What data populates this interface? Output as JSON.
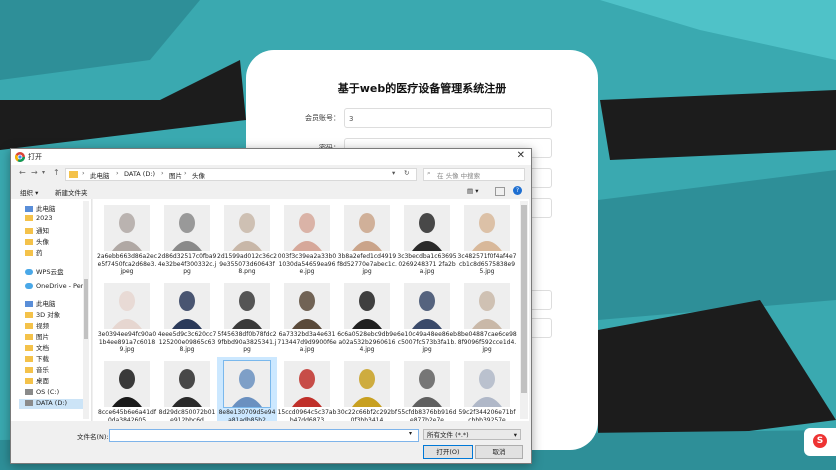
{
  "background": {
    "teal": "#3aa9b0",
    "dark": "#1c1c1c"
  },
  "form": {
    "title": "基于web的医疗设备管理系统注册",
    "rows": [
      {
        "label": "会员账号：",
        "value": "3"
      },
      {
        "label": "密码：",
        "value": ""
      }
    ]
  },
  "dialog": {
    "title": "打开",
    "close": "✕",
    "breadcrumbs": [
      "此电脑",
      "DATA (D:)",
      "图片",
      "头像"
    ],
    "search_placeholder": "在 头像 中搜索",
    "toolbar": {
      "organize": "组织 ▾",
      "new_folder": "新建文件夹"
    },
    "sidebar": [
      {
        "label": "此电脑",
        "icon": "pc"
      },
      {
        "label": "2023",
        "icon": "folder"
      },
      {
        "label": "通知",
        "icon": "folder"
      },
      {
        "label": "头像",
        "icon": "folder"
      },
      {
        "label": "药",
        "icon": "folder"
      },
      {
        "label": "WPS云盘",
        "icon": "cloud"
      },
      {
        "label": "OneDrive - Pers",
        "icon": "cloud"
      },
      {
        "label": "此电脑",
        "icon": "pc"
      },
      {
        "label": "3D 对象",
        "icon": "folder"
      },
      {
        "label": "视频",
        "icon": "folder"
      },
      {
        "label": "图片",
        "icon": "folder"
      },
      {
        "label": "文档",
        "icon": "folder"
      },
      {
        "label": "下载",
        "icon": "folder"
      },
      {
        "label": "音乐",
        "icon": "folder"
      },
      {
        "label": "桌面",
        "icon": "folder"
      },
      {
        "label": "OS (C:)",
        "icon": "drive"
      },
      {
        "label": "DATA (D:)",
        "icon": "drive"
      }
    ],
    "files": [
      {
        "name": "2a6ebb663d86a2ece5f7450fca2d68e3.jpeg",
        "color": "#b0a8a4"
      },
      {
        "name": "2d86d32517c0fba94e32be4f300332c.jpg",
        "color": "#8a8a8a"
      },
      {
        "name": "2d1599ad012c36c29e355073d60643f8.png",
        "color": "#c8b7a8"
      },
      {
        "name": "003f3c39ea2a33b01030da54659ea96e.jpg",
        "color": "#d6a89a"
      },
      {
        "name": "3b8a2efed1cd4919f8d52770e7abec1c.jpg",
        "color": "#caa48a"
      },
      {
        "name": "3c3becdba1c636950269248371 2fa2ba.jpg",
        "color": "#2a2a2a"
      },
      {
        "name": "3c482571f0f4af4e7cb1c8d6575838e95.jpg",
        "color": "#d8b89a"
      },
      {
        "name": "3e0394ee94fc90a01b4ee891a7c60189.jpg",
        "color": "#e6d6d0"
      },
      {
        "name": "4eee5d9c3c620cc7125200e09865c638.jpg",
        "color": "#2b3a5a"
      },
      {
        "name": "5f45638df0b78fdc29fbbd90a3825341.jpg",
        "color": "#3a3a3a"
      },
      {
        "name": "6a7332bd3a4e631713447d9d9900f6ea.jpg",
        "color": "#5a4a3a"
      },
      {
        "name": "6c6a0528ebc9db9ea02a532b29606164.jpg",
        "color": "#202020"
      },
      {
        "name": "6e10c49a48ee86ebc5007fc573b3fa1b.jpg",
        "color": "#3a4a6a"
      },
      {
        "name": "8be04887cae6ce988f9096f592cce1d4.jpg",
        "color": "#c9b8a8"
      },
      {
        "name": "8cce645b6e6a41df0da3842605",
        "color": "#1a1a1a"
      },
      {
        "name": "8d29dc850072b01e912bbc6d",
        "color": "#2a2a2a"
      },
      {
        "name": "8e8e130709d5e94a81adb85b2",
        "color": "#6a90c0"
      },
      {
        "name": "15ccd0964c5c37abb47dd6873",
        "color": "#c0302a"
      },
      {
        "name": "30c22c66bf2c292bf0f3bb3414",
        "color": "#c8a020"
      },
      {
        "name": "55cfdb8376bb916de877b2e7e",
        "color": "#606060"
      },
      {
        "name": "59c2f344206e71bfcbbb39257e",
        "color": "#b0b8c8"
      }
    ],
    "file_name_label": "文件名(N):",
    "file_name_value": "",
    "file_type": "所有文件 (*.*)",
    "open_button": "打开(O)",
    "cancel_button": "取消"
  },
  "overlay_chip": "S"
}
